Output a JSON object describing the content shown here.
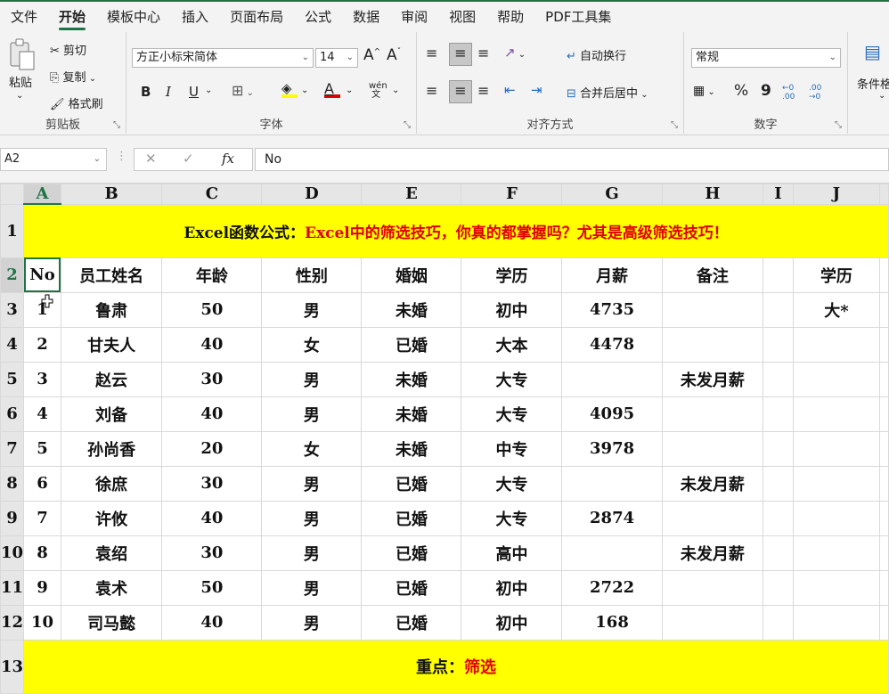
{
  "menu": {
    "items": [
      "文件",
      "开始",
      "模板中心",
      "插入",
      "页面布局",
      "公式",
      "数据",
      "审阅",
      "视图",
      "帮助",
      "PDF工具集"
    ],
    "active_index": 1
  },
  "ribbon": {
    "clipboard": {
      "paste": "粘贴",
      "cut": "剪切",
      "copy": "复制",
      "format_painter": "格式刷",
      "group": "剪贴板"
    },
    "font": {
      "font_name": "方正小标宋简体",
      "font_size": "14",
      "bold": "B",
      "italic": "I",
      "underline": "U",
      "grow": "A^",
      "shrink": "Aˇ",
      "font_color_letter": "A",
      "phonetic": "wén 文",
      "group": "字体"
    },
    "alignment": {
      "wrap_text": "自动换行",
      "merge_center": "合并后居中",
      "group": "对齐方式"
    },
    "number": {
      "format": "常规",
      "percent": "%",
      "comma": "9",
      "inc_decimal": "←0 .00",
      "dec_decimal": ".00 →0",
      "group": "数字"
    },
    "styles": {
      "conditional": "条件格"
    }
  },
  "formula_bar": {
    "name_box": "A2",
    "fx": "fx",
    "content": "No"
  },
  "sheet": {
    "columns": [
      "A",
      "B",
      "C",
      "D",
      "E",
      "F",
      "G",
      "H",
      "I",
      "J"
    ],
    "rows": [
      "1",
      "2",
      "3",
      "4",
      "5",
      "6",
      "7",
      "8",
      "9",
      "10",
      "11",
      "12",
      "13"
    ],
    "title_prefix": "Excel函数公式：",
    "title_red": "Excel中的筛选技巧，你真的都掌握吗？尤其是高级筛选技巧！",
    "headers": [
      "No",
      "员工姓名",
      "年龄",
      "性别",
      "婚姻",
      "学历",
      "月薪",
      "备注"
    ],
    "data": [
      [
        "1",
        "鲁肃",
        "50",
        "男",
        "未婚",
        "初中",
        "4735",
        ""
      ],
      [
        "2",
        "甘夫人",
        "40",
        "女",
        "已婚",
        "大本",
        "4478",
        ""
      ],
      [
        "3",
        "赵云",
        "30",
        "男",
        "未婚",
        "大专",
        "",
        "未发月薪"
      ],
      [
        "4",
        "刘备",
        "40",
        "男",
        "未婚",
        "大专",
        "4095",
        ""
      ],
      [
        "5",
        "孙尚香",
        "20",
        "女",
        "未婚",
        "中专",
        "3978",
        ""
      ],
      [
        "6",
        "徐庶",
        "30",
        "男",
        "已婚",
        "大专",
        "",
        "未发月薪"
      ],
      [
        "7",
        "许攸",
        "40",
        "男",
        "已婚",
        "大专",
        "2874",
        ""
      ],
      [
        "8",
        "袁绍",
        "30",
        "男",
        "已婚",
        "高中",
        "",
        "未发月薪"
      ],
      [
        "9",
        "袁术",
        "50",
        "男",
        "已婚",
        "初中",
        "2722",
        ""
      ],
      [
        "10",
        "司马懿",
        "40",
        "男",
        "已婚",
        "初中",
        "168",
        ""
      ]
    ],
    "criteria_header": "学历",
    "criteria_value": "大*",
    "footer_prefix": "重点：",
    "footer_red": "筛选"
  },
  "colors": {
    "accent": "#217346",
    "highlight": "#ffff00",
    "red_text": "#e00000"
  }
}
